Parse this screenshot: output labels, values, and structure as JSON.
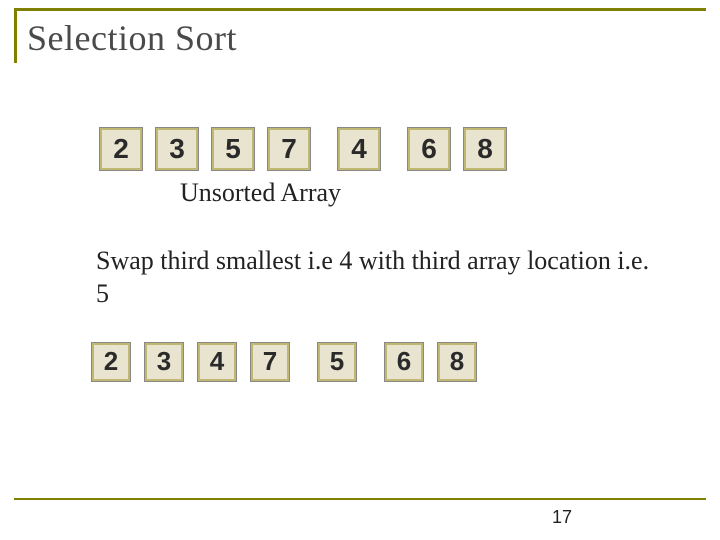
{
  "title": "Selection Sort",
  "array_before": [
    "2",
    "3",
    "5",
    "7",
    "4",
    "6",
    "8"
  ],
  "label_unsorted": "Unsorted Array",
  "description": "Swap third smallest i.e 4 with third array location i.e. 5",
  "array_after": [
    "2",
    "3",
    "4",
    "7",
    "5",
    "6",
    "8"
  ],
  "page_number": "17"
}
